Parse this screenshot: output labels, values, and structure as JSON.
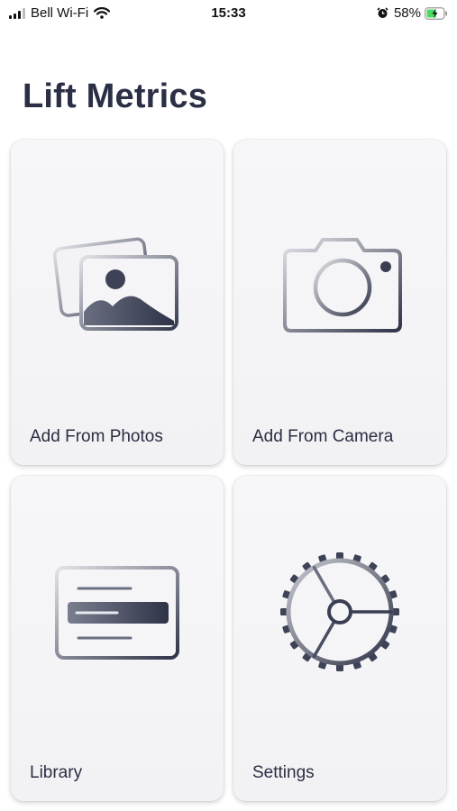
{
  "status_bar": {
    "carrier": "Bell Wi-Fi",
    "time": "15:33",
    "battery_percent": "58%",
    "battery_level": 0.58,
    "icons": [
      "signal-icon",
      "wifi-icon",
      "alarm-icon",
      "battery-charging-icon"
    ]
  },
  "app": {
    "title": "Lift Metrics"
  },
  "tiles": [
    {
      "label": "Add From Photos",
      "icon": "photos-icon"
    },
    {
      "label": "Add From Camera",
      "icon": "camera-icon"
    },
    {
      "label": "Library",
      "icon": "library-icon"
    },
    {
      "label": "Settings",
      "icon": "settings-gear-icon"
    }
  ],
  "colors": {
    "icon_dark": "#3a3e52",
    "icon_light": "#d8d9de",
    "title": "#2b2f45",
    "card": "#f4f4f6"
  }
}
